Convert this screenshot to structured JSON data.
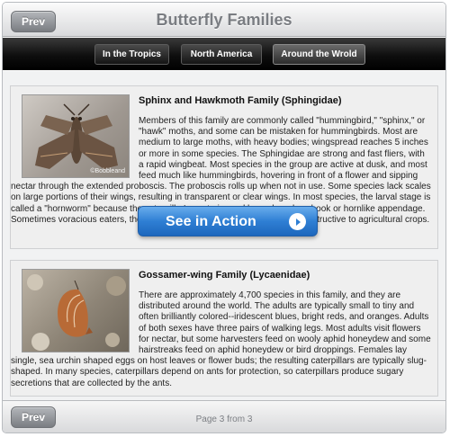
{
  "header": {
    "title": "Butterfly Families",
    "prev_label": "Prev"
  },
  "nav": {
    "tabs": [
      {
        "label": "In the Tropics"
      },
      {
        "label": "North America"
      },
      {
        "label": "Around the Wrold"
      }
    ]
  },
  "cards": [
    {
      "title": "Sphinx and Hawkmoth Family (Sphingidae)",
      "body": "Members of this family are commonly called \"hummingbird,\" \"sphinx,\" or \"hawk\" moths, and some can be mistaken for hummingbirds. Most are medium to large moths, with heavy bodies; wingspread reaches 5 inches or more in some species. The Sphingidae are strong and fast fliers, with a rapid wingbeat. Most species in the group are active at dusk, and most feed much like hummingbirds, hovering in front of a flower and sipping nectar through the extended proboscis. The proboscis rolls up when not in use. Some species lack scales on large portions of their wings, resulting in transparent or clear wings. In most species, the larval stage is called a \"hornworm\" because the caterpillar's posterior end has a harmless hook or hornlike appendage. Sometimes voracious eaters, the caterpillar of some species can be very destructive to agricultural crops.",
      "image_watermark": "©Bobbleand"
    },
    {
      "title": "Gossamer-wing Family (Lycaenidae)",
      "body": "There are approximately 4,700 species in this family, and they are distributed around the world. The adults are typically small to tiny and often brilliantly colored--iridescent blues, bright reds, and oranges. Adults of both sexes have three pairs of walking legs. Most adults visit flowers for nectar, but some harvesters feed on wooly aphid honeydew and some hairstreaks feed on aphid honeydew or bird droppings. Females lay single, sea urchin shaped eggs on host leaves or flower buds; the resulting caterpillars are typically slug-shaped. In many species, caterpillars depend on ants for protection, so caterpillars produce sugary secretions that are collected by the ants."
    }
  ],
  "action": {
    "label": "See in Action",
    "icon": "arrow-circle-right-icon"
  },
  "footer": {
    "prev_label": "Prev",
    "page_info": "Page 3 from 3"
  },
  "colors": {
    "accent_button": "#2f7fd4",
    "navbar": "#000000",
    "title_text": "#7a7d82"
  }
}
